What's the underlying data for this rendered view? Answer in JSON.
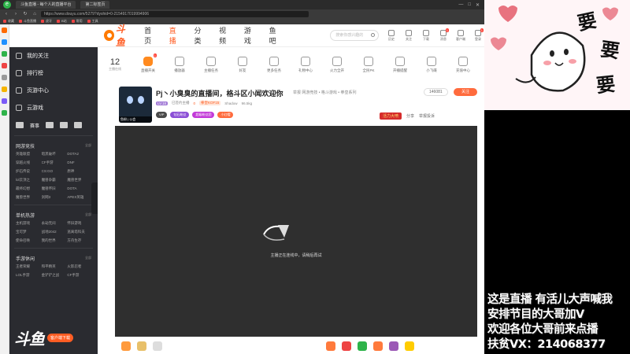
{
  "browser": {
    "tabs": [
      "斗鱼直播 - 每个人的直播平台",
      "第二标签页"
    ],
    "url": "https://www.douyu.com/5279?dyshid=0-2154917019994906",
    "bookmarks": [
      "收藏",
      "斗鱼直播",
      "虎牙",
      "B站",
      "常用",
      "工具"
    ]
  },
  "header": {
    "logo_text": "斗鱼",
    "nav": [
      "首页",
      "直播",
      "分类",
      "视频",
      "游戏",
      "鱼吧"
    ],
    "search_placeholder": "搜索你感兴趣的",
    "icons": [
      {
        "icon": "history-icon",
        "label": "历史"
      },
      {
        "icon": "follow-icon",
        "label": "关注"
      },
      {
        "icon": "download-icon",
        "label": "下载"
      },
      {
        "icon": "message-icon",
        "label": "消息",
        "badge": "1"
      },
      {
        "icon": "client-icon",
        "label": "客户端"
      },
      {
        "icon": "login-icon",
        "label": "登录",
        "badge": "1"
      }
    ]
  },
  "sidebar": {
    "main_items": [
      "我的关注",
      "排行榜",
      "页游中心",
      "云游戏"
    ],
    "games_row": [
      "赛事"
    ],
    "sections": [
      {
        "title": "网游竞技",
        "all": "全部",
        "items": [
          "英雄联盟",
          "暗黑破坏",
          "DOTA2",
          "穿越火线",
          "CF手游",
          "DNF",
          "炉石传说",
          "CS:GO",
          "原神",
          "lol云顶之",
          "魔兽争霸",
          "魔兽世界",
          "最终幻想",
          "魔兽怀旧",
          "DOTA",
          "魔兽世界",
          "剑网3",
          "APEX英雄"
        ]
      },
      {
        "title": "单机热游",
        "all": "全部",
        "items": [
          "主机游戏",
          "永劫无间",
          "怀旧游戏",
          "宝可梦",
          "战地2042",
          "逃离塔科夫",
          "使命召唤",
          "我的世界",
          "方舟生存"
        ]
      },
      {
        "title": "手游休闲",
        "all": "全部",
        "items": [
          "王者荣耀",
          "和平精英",
          "火影忍者",
          "LOL手游",
          "金铲铲之战",
          "CF手游"
        ]
      }
    ],
    "footer_logo": "斗鱼",
    "footer_button": "客户端下载"
  },
  "categories": {
    "follow_count": "12",
    "follow_label": "主播在线",
    "items": [
      {
        "label": "直播开关",
        "badge": "1",
        "live": true
      },
      {
        "label": "播放器",
        "live": false
      },
      {
        "label": "主播任务",
        "live": false
      },
      {
        "label": "好友",
        "live": false
      },
      {
        "label": "更多任务",
        "live": false
      },
      {
        "label": "礼物中心",
        "live": false
      },
      {
        "label": "火力全开",
        "live": false
      },
      {
        "label": "全民PK",
        "live": false
      },
      {
        "label": "开播提醒",
        "live": false
      },
      {
        "label": "小飞碟",
        "live": false
      },
      {
        "label": "充值中心",
        "live": false
      }
    ]
  },
  "room": {
    "title": "Pj丶小臭臭的直播间，格斗区小闻欢迎你",
    "category": "举报  网游竞技 • 格斗游戏 • 拳皇系列",
    "room_id": "146081",
    "follow_label": "关注",
    "avatar_tag": "鱼粉 | 公会",
    "meta": {
      "level": "LV.18",
      "level_desc": "已签约主播",
      "hot": "0",
      "tag": "拳皇KOF15",
      "shadow": "Shadow",
      "views": "96.5kg"
    },
    "badges": [
      "VIP",
      "钻石粉丝",
      "超级粉丝团",
      "小红帽"
    ],
    "actions": {
      "red_label": "活力大喷",
      "share": "分享",
      "report": "举报投诉"
    }
  },
  "player": {
    "loading_text": "主播正在连线中，请稍后再试"
  },
  "overlay": {
    "lines": [
      "这是直播 有活儿大声喊我",
      "安排节目的大哥加V",
      "欢迎各位大哥前来点播",
      "扶贫VX：214068377"
    ],
    "meme_text": [
      "要",
      "要",
      "要"
    ]
  },
  "colors": {
    "brand": "#ff5d23",
    "sidebar_bg": "#2a2b30",
    "player_bg": "#2f2f2f"
  }
}
